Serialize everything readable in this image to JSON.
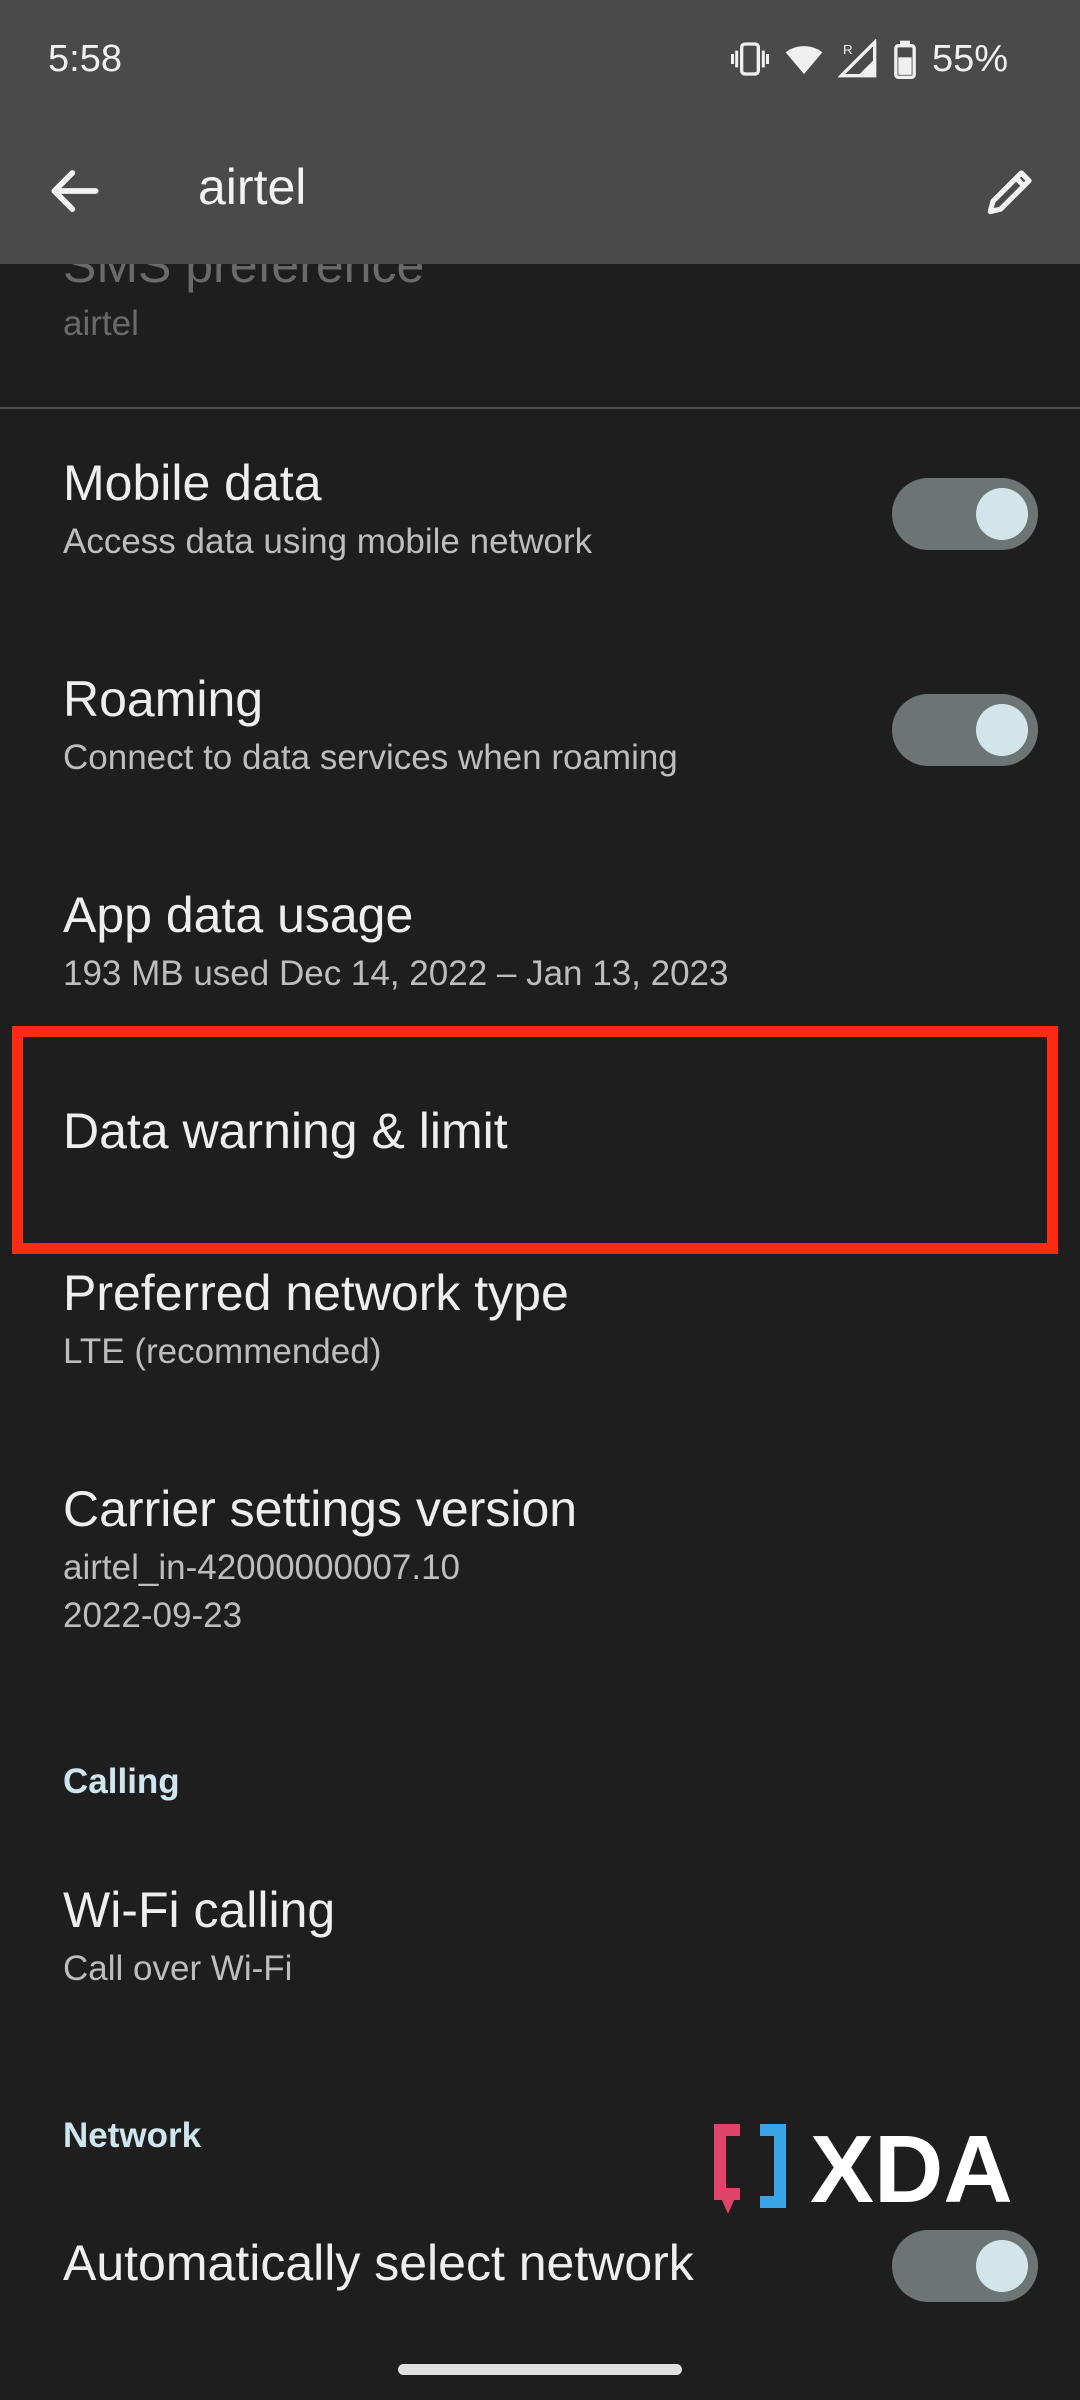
{
  "status": {
    "time": "5:58",
    "battery": "55%",
    "roaming_indicator": "R"
  },
  "appbar": {
    "title": "airtel"
  },
  "items": {
    "sms": {
      "title": "SMS preference",
      "subtitle": "airtel"
    },
    "mobile_data": {
      "title": "Mobile data",
      "subtitle": "Access data using mobile network",
      "enabled": true
    },
    "roaming": {
      "title": "Roaming",
      "subtitle": "Connect to data services when roaming",
      "enabled": true
    },
    "app_data_usage": {
      "title": "App data usage",
      "subtitle": "193 MB used Dec 14, 2022 – Jan 13, 2023"
    },
    "data_warning": {
      "title": "Data warning & limit"
    },
    "preferred_network": {
      "title": "Preferred network type",
      "subtitle": "LTE (recommended)"
    },
    "carrier_settings": {
      "title": "Carrier settings version",
      "subtitle_line1": "airtel_in-42000000007.10",
      "subtitle_line2": "2022-09-23"
    },
    "wifi_calling": {
      "title": "Wi-Fi calling",
      "subtitle": "Call over Wi-Fi"
    },
    "auto_network": {
      "title": "Automatically select network",
      "enabled": true
    }
  },
  "sections": {
    "calling": "Calling",
    "network": "Network"
  },
  "watermark": {
    "text": "XDA"
  },
  "colors": {
    "background": "#1e1e1e",
    "toolbar": "#4a4a4a",
    "highlight": "#ff2a12",
    "accent_section": "#cfe6f0",
    "toggle_track": "#6d7474",
    "toggle_knob": "#d3e5ea"
  }
}
